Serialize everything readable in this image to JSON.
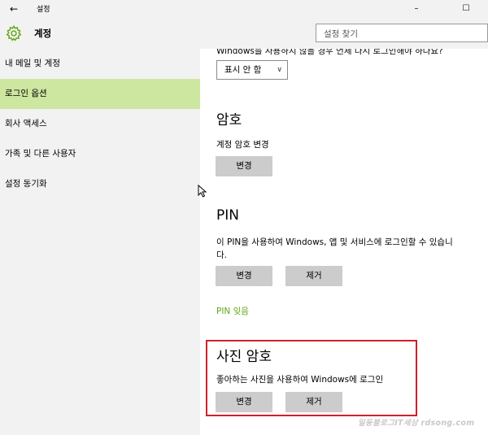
{
  "window": {
    "title": "설정",
    "back_glyph": "←",
    "minimize_glyph": "–",
    "maximize_glyph": "☐"
  },
  "header": {
    "app_title": "계정",
    "search_placeholder": "설정 찾기"
  },
  "sidebar": {
    "items": [
      {
        "label": "내 메일 및 계정"
      },
      {
        "label": "로그인 옵션",
        "active": true
      },
      {
        "label": "회사 액세스"
      },
      {
        "label": "가족 및 다른 사용자"
      },
      {
        "label": "설정 동기화"
      }
    ]
  },
  "content": {
    "cut_text": "Windows를 사용하지 않을 경우 언제 다시 로그인해야 하나요?",
    "dropdown_value": "표시 안 함",
    "password": {
      "title": "암호",
      "desc": "계정 암호 변경",
      "change_label": "변경"
    },
    "pin": {
      "title": "PIN",
      "desc_line1": "이 PIN을 사용하여 Windows, 앱 및 서비스에 로그인할 수 있습니",
      "desc_line2": "다.",
      "change_label": "변경",
      "remove_label": "제거",
      "forgot_link": "PIN 잊음"
    },
    "picture_password": {
      "title": "사진 암호",
      "desc": "좋아하는 사진을 사용하여 Windows에 로그인",
      "change_label": "변경",
      "remove_label": "제거"
    }
  },
  "watermark": "일등블로그IT세상 rdsong.com",
  "colors": {
    "accent_green": "#62a818",
    "active_nav": "#cde6a0",
    "highlight_red": "#d0202a",
    "button_gray": "#cccccc"
  }
}
